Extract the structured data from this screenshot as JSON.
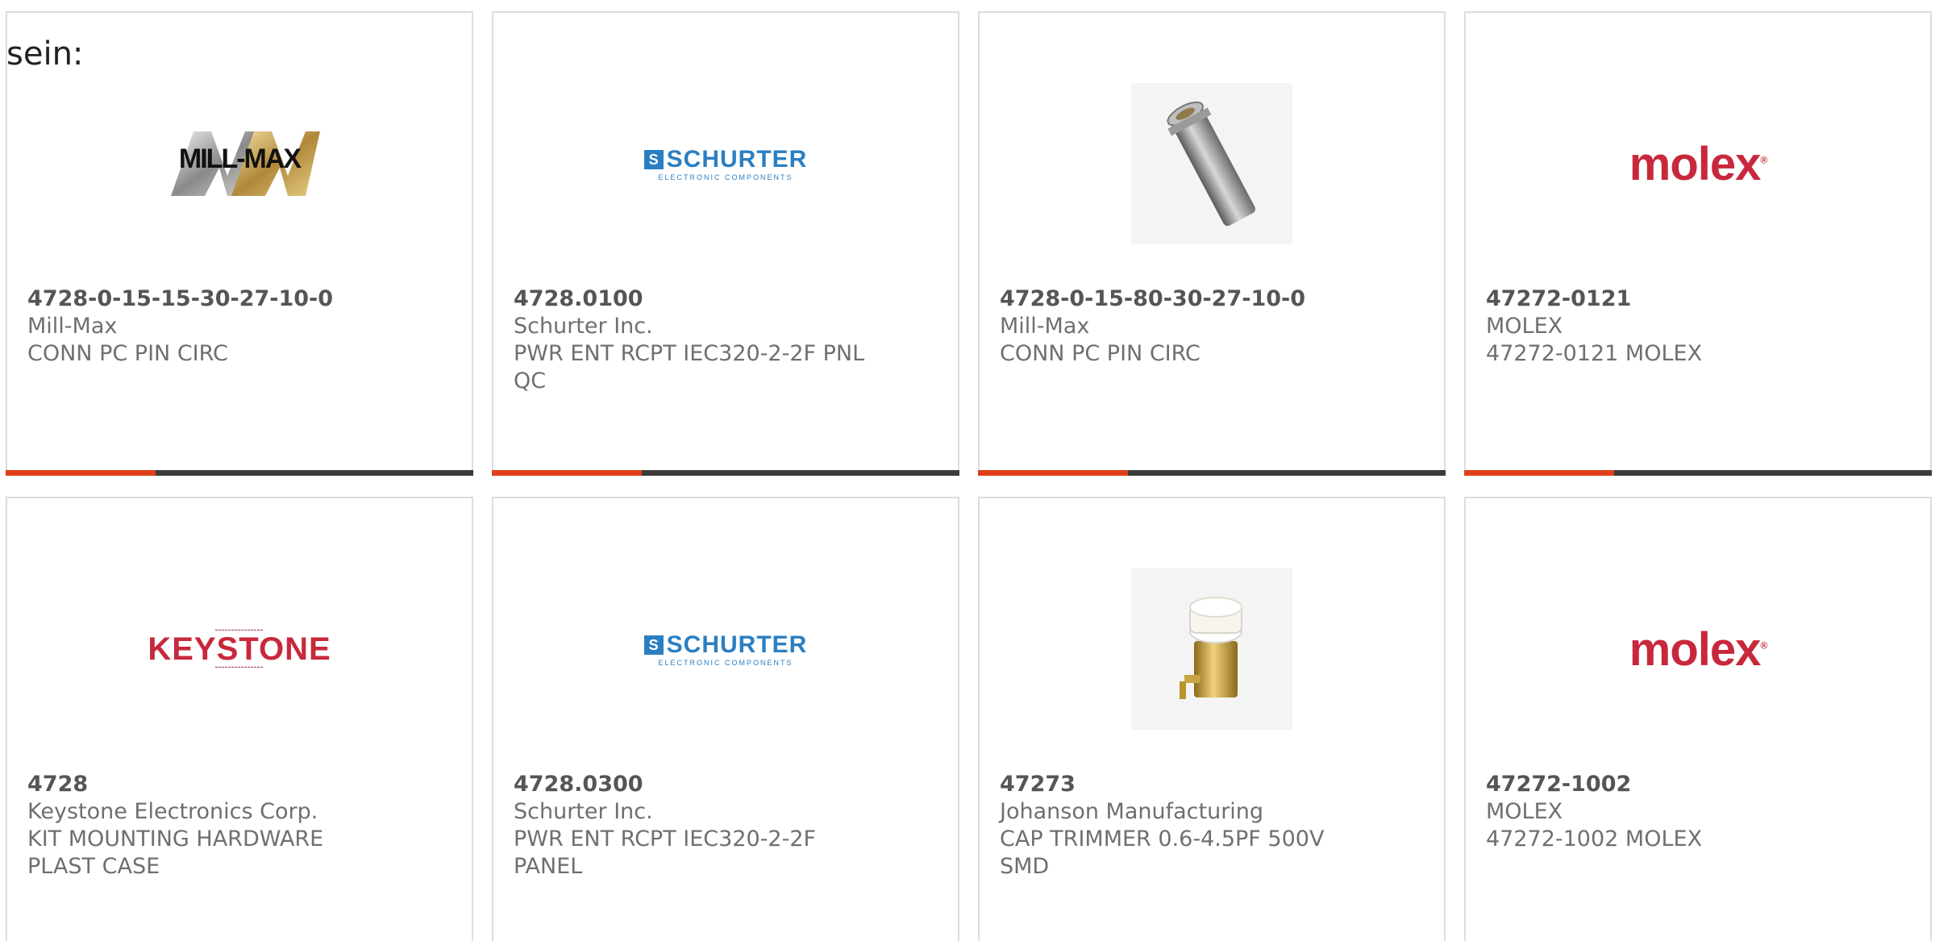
{
  "intro_text": "sein:",
  "colors": {
    "progress_fill": "#e0401a",
    "progress_track": "#3b3b3b",
    "card_border": "#dddddd",
    "text": "#6f6f6f"
  },
  "products": [
    {
      "part_number": "4728-0-15-15-30-27-10-0",
      "manufacturer": "Mill-Max",
      "description": "CONN PC PIN CIRC",
      "image": "mill-max-logo",
      "logo_text": "MILL-MAX",
      "progress": 0.32
    },
    {
      "part_number": "4728.0100",
      "manufacturer": "Schurter Inc.",
      "description": "PWR ENT RCPT IEC320-2-2F PNL QC",
      "image": "schurter-logo",
      "logo_text": "SCHURTER",
      "logo_subtext": "ELECTRONIC COMPONENTS",
      "progress": 0.32
    },
    {
      "part_number": "4728-0-15-80-30-27-10-0",
      "manufacturer": "Mill-Max",
      "description": "CONN PC PIN CIRC",
      "image": "pc-pin-photo",
      "progress": 0.32
    },
    {
      "part_number": "47272-0121",
      "manufacturer": "MOLEX",
      "description": "47272-0121 MOLEX",
      "image": "molex-logo",
      "logo_text": "molex",
      "progress": 0.32
    },
    {
      "part_number": "4728",
      "manufacturer": "Keystone Electronics Corp.",
      "description": "KIT MOUNTING HARDWARE PLAST CASE",
      "image": "keystone-logo",
      "logo_text": "KEYSTONE",
      "progress": null
    },
    {
      "part_number": "4728.0300",
      "manufacturer": "Schurter Inc.",
      "description": "PWR ENT RCPT IEC320-2-2F PANEL",
      "image": "schurter-logo",
      "logo_text": "SCHURTER",
      "logo_subtext": "ELECTRONIC COMPONENTS",
      "progress": null
    },
    {
      "part_number": "47273",
      "manufacturer": "Johanson Manufacturing",
      "description": "CAP TRIMMER 0.6-4.5PF 500V SMD",
      "image": "trimmer-capacitor-photo",
      "progress": null
    },
    {
      "part_number": "47272-1002",
      "manufacturer": "MOLEX",
      "description": "47272-1002 MOLEX",
      "image": "molex-logo",
      "logo_text": "molex",
      "progress": null
    }
  ]
}
